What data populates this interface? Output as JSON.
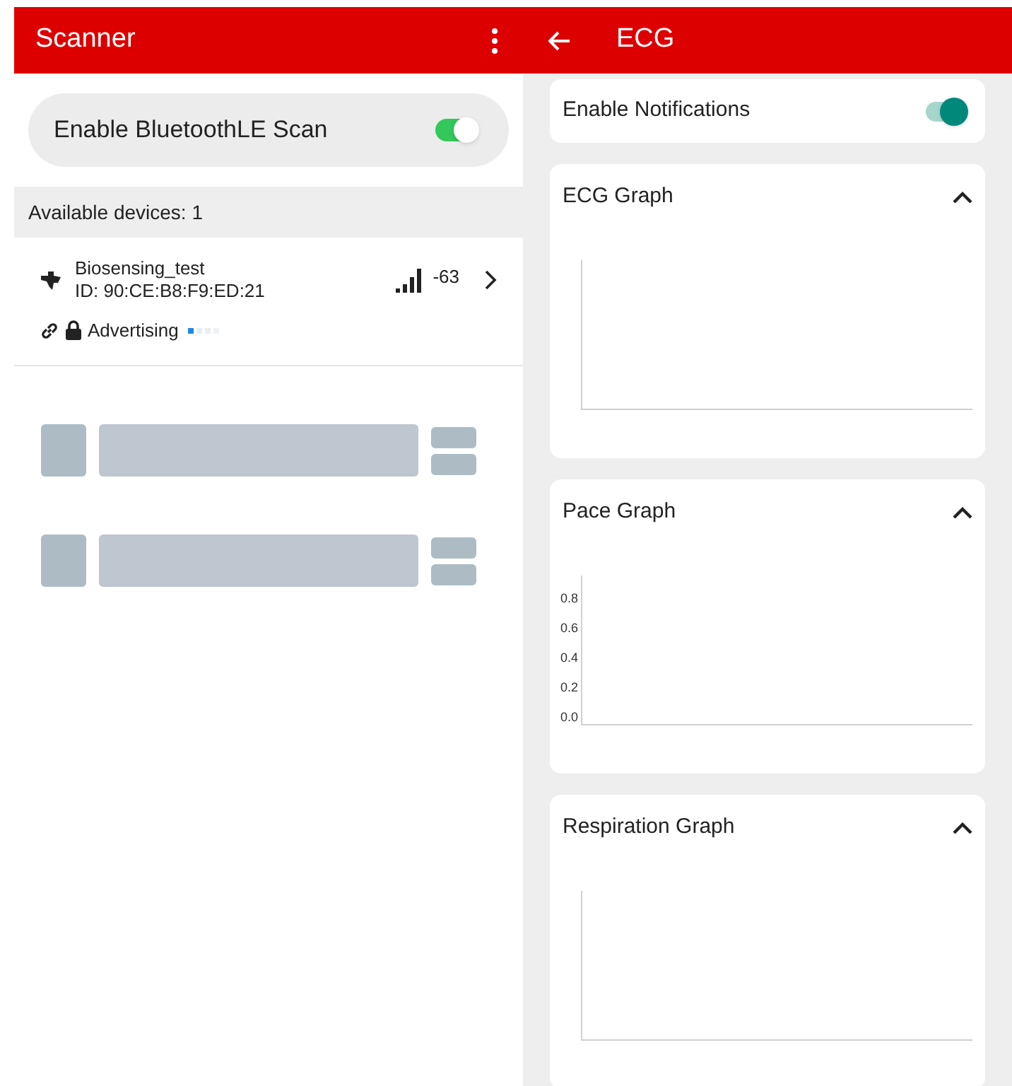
{
  "scanner": {
    "title": "Scanner",
    "scan_toggle": {
      "label": "Enable BluetoothLE Scan",
      "on": true
    },
    "section_header": "Available devices: 1",
    "devices": [
      {
        "name": "Biosensing_test",
        "id": "ID: 90:CE:B8:F9:ED:21",
        "rssi": "-63",
        "status": "Advertising"
      }
    ],
    "skeleton_rows": [
      {
        "kind": "placeholder"
      },
      {
        "kind": "placeholder"
      }
    ]
  },
  "ecg": {
    "title": "ECG",
    "notifications": {
      "label": "Enable Notifications",
      "on": true
    },
    "graphs": [
      {
        "title": "ECG Graph",
        "expanded": true
      },
      {
        "title": "Pace Graph",
        "expanded": true,
        "y_tick_labels": [
          "0.8",
          "0.6",
          "0.4",
          "0.2",
          "0.0"
        ]
      },
      {
        "title": "Respiration Graph",
        "expanded": true
      }
    ]
  }
}
